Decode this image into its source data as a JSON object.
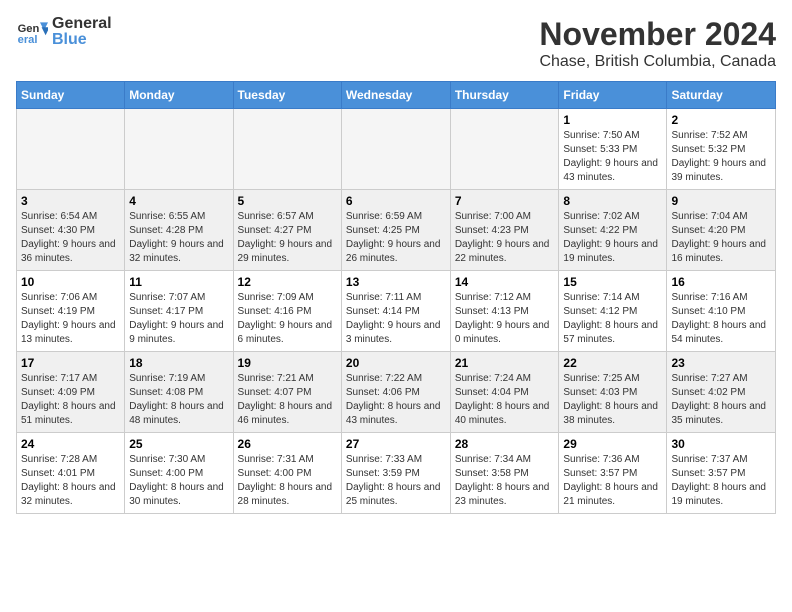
{
  "header": {
    "logo": {
      "general": "General",
      "blue": "Blue"
    },
    "title": "November 2024",
    "subtitle": "Chase, British Columbia, Canada"
  },
  "days_of_week": [
    "Sunday",
    "Monday",
    "Tuesday",
    "Wednesday",
    "Thursday",
    "Friday",
    "Saturday"
  ],
  "weeks": [
    [
      {
        "day": "",
        "info": ""
      },
      {
        "day": "",
        "info": ""
      },
      {
        "day": "",
        "info": ""
      },
      {
        "day": "",
        "info": ""
      },
      {
        "day": "",
        "info": ""
      },
      {
        "day": "1",
        "info": "Sunrise: 7:50 AM\nSunset: 5:33 PM\nDaylight: 9 hours and 43 minutes."
      },
      {
        "day": "2",
        "info": "Sunrise: 7:52 AM\nSunset: 5:32 PM\nDaylight: 9 hours and 39 minutes."
      }
    ],
    [
      {
        "day": "3",
        "info": "Sunrise: 6:54 AM\nSunset: 4:30 PM\nDaylight: 9 hours and 36 minutes."
      },
      {
        "day": "4",
        "info": "Sunrise: 6:55 AM\nSunset: 4:28 PM\nDaylight: 9 hours and 32 minutes."
      },
      {
        "day": "5",
        "info": "Sunrise: 6:57 AM\nSunset: 4:27 PM\nDaylight: 9 hours and 29 minutes."
      },
      {
        "day": "6",
        "info": "Sunrise: 6:59 AM\nSunset: 4:25 PM\nDaylight: 9 hours and 26 minutes."
      },
      {
        "day": "7",
        "info": "Sunrise: 7:00 AM\nSunset: 4:23 PM\nDaylight: 9 hours and 22 minutes."
      },
      {
        "day": "8",
        "info": "Sunrise: 7:02 AM\nSunset: 4:22 PM\nDaylight: 9 hours and 19 minutes."
      },
      {
        "day": "9",
        "info": "Sunrise: 7:04 AM\nSunset: 4:20 PM\nDaylight: 9 hours and 16 minutes."
      }
    ],
    [
      {
        "day": "10",
        "info": "Sunrise: 7:06 AM\nSunset: 4:19 PM\nDaylight: 9 hours and 13 minutes."
      },
      {
        "day": "11",
        "info": "Sunrise: 7:07 AM\nSunset: 4:17 PM\nDaylight: 9 hours and 9 minutes."
      },
      {
        "day": "12",
        "info": "Sunrise: 7:09 AM\nSunset: 4:16 PM\nDaylight: 9 hours and 6 minutes."
      },
      {
        "day": "13",
        "info": "Sunrise: 7:11 AM\nSunset: 4:14 PM\nDaylight: 9 hours and 3 minutes."
      },
      {
        "day": "14",
        "info": "Sunrise: 7:12 AM\nSunset: 4:13 PM\nDaylight: 9 hours and 0 minutes."
      },
      {
        "day": "15",
        "info": "Sunrise: 7:14 AM\nSunset: 4:12 PM\nDaylight: 8 hours and 57 minutes."
      },
      {
        "day": "16",
        "info": "Sunrise: 7:16 AM\nSunset: 4:10 PM\nDaylight: 8 hours and 54 minutes."
      }
    ],
    [
      {
        "day": "17",
        "info": "Sunrise: 7:17 AM\nSunset: 4:09 PM\nDaylight: 8 hours and 51 minutes."
      },
      {
        "day": "18",
        "info": "Sunrise: 7:19 AM\nSunset: 4:08 PM\nDaylight: 8 hours and 48 minutes."
      },
      {
        "day": "19",
        "info": "Sunrise: 7:21 AM\nSunset: 4:07 PM\nDaylight: 8 hours and 46 minutes."
      },
      {
        "day": "20",
        "info": "Sunrise: 7:22 AM\nSunset: 4:06 PM\nDaylight: 8 hours and 43 minutes."
      },
      {
        "day": "21",
        "info": "Sunrise: 7:24 AM\nSunset: 4:04 PM\nDaylight: 8 hours and 40 minutes."
      },
      {
        "day": "22",
        "info": "Sunrise: 7:25 AM\nSunset: 4:03 PM\nDaylight: 8 hours and 38 minutes."
      },
      {
        "day": "23",
        "info": "Sunrise: 7:27 AM\nSunset: 4:02 PM\nDaylight: 8 hours and 35 minutes."
      }
    ],
    [
      {
        "day": "24",
        "info": "Sunrise: 7:28 AM\nSunset: 4:01 PM\nDaylight: 8 hours and 32 minutes."
      },
      {
        "day": "25",
        "info": "Sunrise: 7:30 AM\nSunset: 4:00 PM\nDaylight: 8 hours and 30 minutes."
      },
      {
        "day": "26",
        "info": "Sunrise: 7:31 AM\nSunset: 4:00 PM\nDaylight: 8 hours and 28 minutes."
      },
      {
        "day": "27",
        "info": "Sunrise: 7:33 AM\nSunset: 3:59 PM\nDaylight: 8 hours and 25 minutes."
      },
      {
        "day": "28",
        "info": "Sunrise: 7:34 AM\nSunset: 3:58 PM\nDaylight: 8 hours and 23 minutes."
      },
      {
        "day": "29",
        "info": "Sunrise: 7:36 AM\nSunset: 3:57 PM\nDaylight: 8 hours and 21 minutes."
      },
      {
        "day": "30",
        "info": "Sunrise: 7:37 AM\nSunset: 3:57 PM\nDaylight: 8 hours and 19 minutes."
      }
    ]
  ]
}
